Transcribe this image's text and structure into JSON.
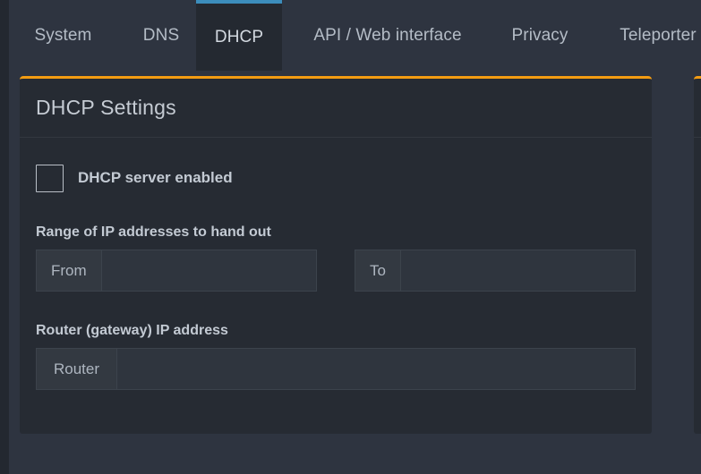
{
  "theme": {
    "page_background": "#2e3440",
    "card_background": "#262b33",
    "accent_orange": "#f39c12",
    "accent_blue": "#3c8dbc",
    "text_primary": "#c8cdd4",
    "input_background": "#2f353e",
    "input_prepend_background": "#333941"
  },
  "tabs": [
    {
      "label": "System",
      "active": false
    },
    {
      "label": "DNS",
      "active": false
    },
    {
      "label": "DHCP",
      "active": true
    },
    {
      "label": "API / Web interface",
      "active": false
    },
    {
      "label": "Privacy",
      "active": false
    },
    {
      "label": "Teleporter",
      "active": false
    }
  ],
  "card": {
    "title": "DHCP Settings",
    "checkbox": {
      "label": "DHCP server enabled",
      "checked": false
    },
    "range_section": {
      "label": "Range of IP addresses to hand out",
      "from": {
        "prepend": "From",
        "value": "",
        "placeholder": ""
      },
      "to": {
        "prepend": "To",
        "value": "",
        "placeholder": ""
      }
    },
    "router_section": {
      "label": "Router (gateway) IP address",
      "router": {
        "prepend": "Router",
        "value": "",
        "placeholder": ""
      }
    }
  }
}
